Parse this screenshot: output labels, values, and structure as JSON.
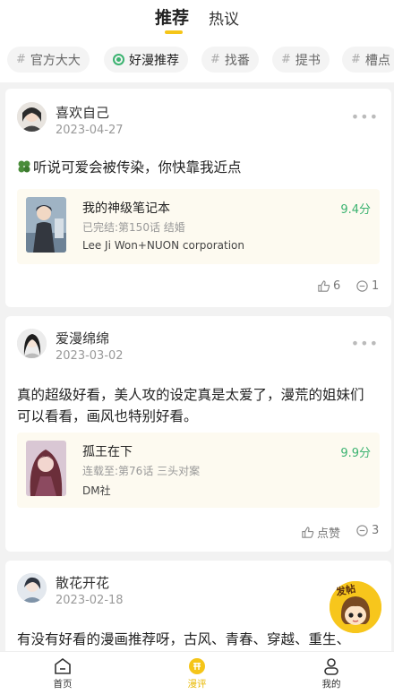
{
  "header": {
    "tabs": [
      {
        "label": "推荐",
        "active": true
      },
      {
        "label": "热议",
        "active": false
      }
    ]
  },
  "chips": [
    {
      "label": "官方大大",
      "prefix": "#"
    },
    {
      "label": "好漫推荐",
      "prefix": "",
      "active": true
    },
    {
      "label": "找番",
      "prefix": "#"
    },
    {
      "label": "提书",
      "prefix": "#"
    },
    {
      "label": "槽点",
      "prefix": "#"
    }
  ],
  "posts": [
    {
      "username": "喜欢自己",
      "date": "2023-04-27",
      "text": "听说可爱会被传染，你快靠我近点",
      "book": {
        "title": "我的神级笔记本",
        "status": "已完结:第150话 结婚",
        "author": "Lee Ji Won+NUON corporation",
        "score": "9.4分"
      },
      "likes": "6",
      "comments": "1"
    },
    {
      "username": "爱漫绵绵",
      "date": "2023-03-02",
      "text": "真的超级好看，美人攻的设定真是太爱了，漫荒的姐妹们可以看看，画风也特别好看。",
      "book": {
        "title": "孤王在下",
        "status": "连载至:第76话 三头对案",
        "author": "DM社",
        "score": "9.9分"
      },
      "likes": "点赞",
      "comments": "3"
    },
    {
      "username": "散花开花",
      "date": "2023-02-18",
      "text": "有没有好看的漫画推荐呀，古风、青春、穿越、重生、"
    }
  ],
  "fab": {
    "label": "发帖"
  },
  "nav": [
    {
      "label": "首页",
      "icon": "home-icon"
    },
    {
      "label": "漫评",
      "icon": "review-icon",
      "active": true
    },
    {
      "label": "我的",
      "icon": "profile-icon"
    }
  ],
  "colors": {
    "accent": "#f5c518",
    "score": "#3cb371"
  }
}
